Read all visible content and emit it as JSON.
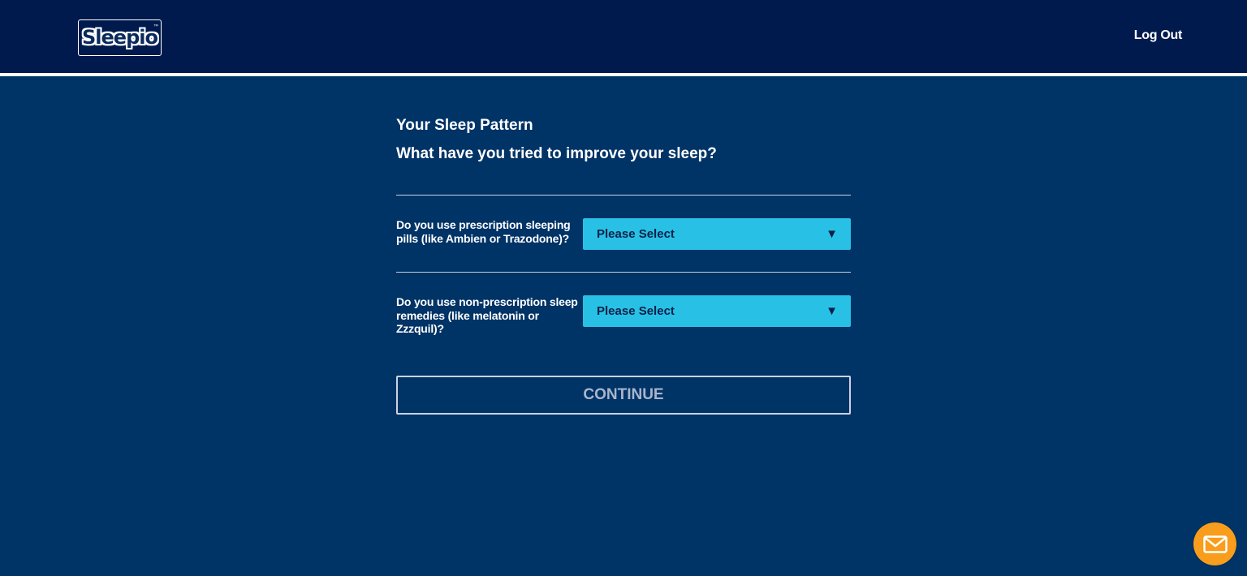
{
  "header": {
    "logo_text": "Sleepio",
    "logo_tm": "™",
    "logout_label": "Log Out"
  },
  "main": {
    "section_title": "Your Sleep Pattern",
    "question_title": "What have you tried to improve your sleep?",
    "questions": [
      {
        "label": "Do you use prescription sleeping pills (like Ambien or Trazodone)?",
        "select_value": "Please Select"
      },
      {
        "label": "Do you use non-prescription sleep remedies (like melatonin or Zzzquil)?",
        "select_value": "Please Select"
      }
    ],
    "continue_label": "CONTINUE"
  },
  "chat": {
    "icon": "mail-icon"
  },
  "colors": {
    "header_bg": "#001a4d",
    "page_bg": "#003366",
    "select_bg": "#29c0e6",
    "chat_bg": "#f99d1c"
  }
}
